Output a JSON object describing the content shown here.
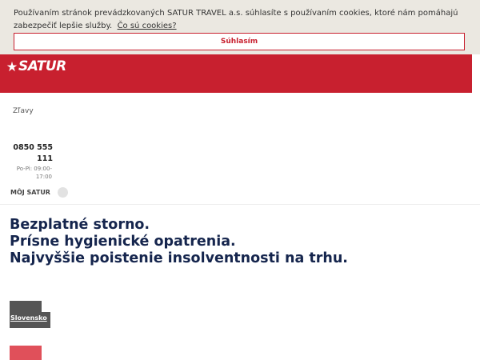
{
  "cookie_banner": {
    "text": "Používaním stránok prevádzkovaných SATUR TRAVEL a.s. súhlasíte s používaním cookies, ktoré nám pomáhajú zabezpečiť lepšie služby.",
    "link_label": "Čo sú cookies?",
    "accept_label": "Súhlasím"
  },
  "header": {
    "logo_text": "SATUR"
  },
  "nav": {
    "discounts_label": "Zľavy"
  },
  "contact": {
    "phone": "0850 555 111",
    "hours": "Po-Pi: 09:00-17:00"
  },
  "account": {
    "label": "MÔJ SATUR"
  },
  "hero": {
    "line1": "Bezplatné storno.",
    "line2": "Prísne hygienické opatrenia.",
    "line3": "Najvyššie poistenie insolventnosti na trhu."
  },
  "tiles": [
    {
      "label": "Slovensko"
    }
  ],
  "colors": {
    "brand_red": "#c8202f",
    "headline_navy": "#15254d",
    "cookie_bg": "#ebe8e1",
    "tile_gray": "#555555"
  }
}
